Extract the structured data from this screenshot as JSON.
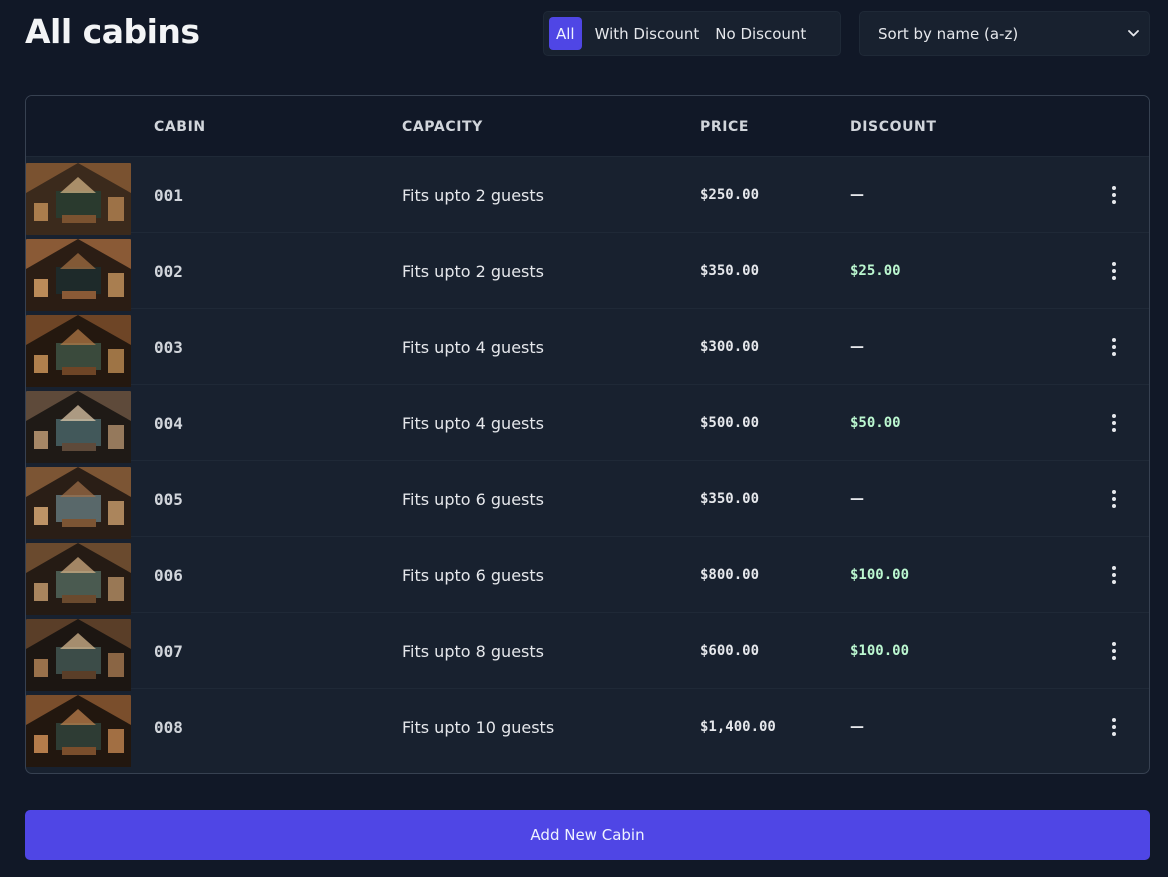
{
  "header": {
    "title": "All cabins"
  },
  "filter": {
    "options": [
      "All",
      "With Discount",
      "No Discount"
    ],
    "active": "All"
  },
  "sort": {
    "selected": "Sort by name (a-z)",
    "icon": "chevron-down-icon"
  },
  "table": {
    "columns": [
      "",
      "CABIN",
      "CAPACITY",
      "PRICE",
      "DISCOUNT",
      ""
    ],
    "rows": [
      {
        "name": "001",
        "capacity": "Fits upto 2 guests",
        "price": "$250.00",
        "discount": "—",
        "has_discount": false
      },
      {
        "name": "002",
        "capacity": "Fits upto 2 guests",
        "price": "$350.00",
        "discount": "$25.00",
        "has_discount": true
      },
      {
        "name": "003",
        "capacity": "Fits upto 4 guests",
        "price": "$300.00",
        "discount": "—",
        "has_discount": false
      },
      {
        "name": "004",
        "capacity": "Fits upto 4 guests",
        "price": "$500.00",
        "discount": "$50.00",
        "has_discount": true
      },
      {
        "name": "005",
        "capacity": "Fits upto 6 guests",
        "price": "$350.00",
        "discount": "—",
        "has_discount": false
      },
      {
        "name": "006",
        "capacity": "Fits upto 6 guests",
        "price": "$800.00",
        "discount": "$100.00",
        "has_discount": true
      },
      {
        "name": "007",
        "capacity": "Fits upto 8 guests",
        "price": "$600.00",
        "discount": "$100.00",
        "has_discount": true
      },
      {
        "name": "008",
        "capacity": "Fits upto 10 guests",
        "price": "$1,400.00",
        "discount": "—",
        "has_discount": false
      }
    ]
  },
  "actions": {
    "add_label": "Add New Cabin"
  },
  "colors": {
    "accent": "#4f46e5",
    "discount": "#bbf7d0",
    "background": "#111827",
    "panel": "#18212f"
  }
}
